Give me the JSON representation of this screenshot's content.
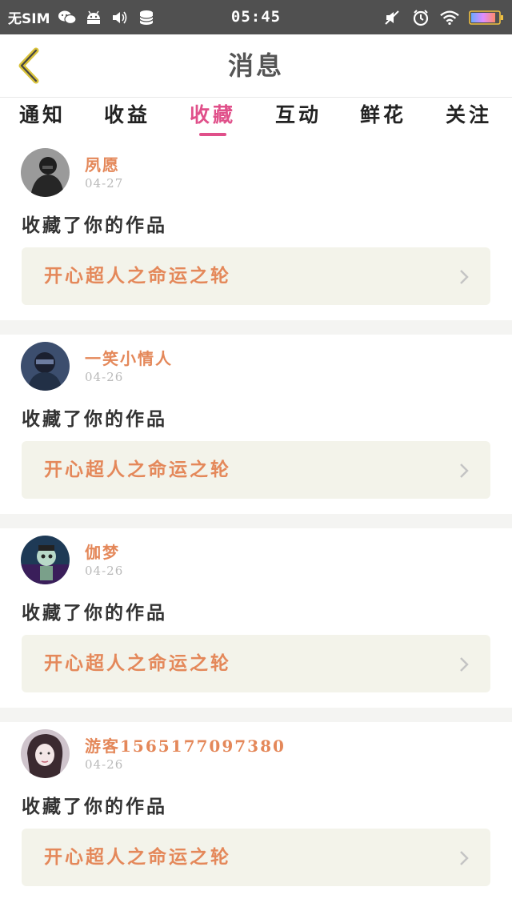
{
  "status_bar": {
    "carrier": "无SIM",
    "time": "05:45",
    "left_icons": [
      "wechat-icon",
      "android-icon",
      "volume-icon",
      "database-icon"
    ],
    "right_icons": [
      "mute-icon",
      "alarm-icon",
      "wifi-icon",
      "battery-icon"
    ]
  },
  "header": {
    "title": "消息"
  },
  "tabs": [
    {
      "label": "通知"
    },
    {
      "label": "收益"
    },
    {
      "label": "收藏"
    },
    {
      "label": "互动"
    },
    {
      "label": "鲜花"
    },
    {
      "label": "关注"
    }
  ],
  "active_tab": "收藏",
  "colors": {
    "accent": "#e0508a",
    "name_text": "#e4885a",
    "card_box": "#f3f3ea"
  },
  "messages": [
    {
      "username": "夙愿",
      "date": "04-27",
      "action": "收藏了你的作品",
      "work_title": "开心超人之命运之轮"
    },
    {
      "username": "一笑小情人",
      "date": "04-26",
      "action": "收藏了你的作品",
      "work_title": "开心超人之命运之轮"
    },
    {
      "username": "伽梦",
      "date": "04-26",
      "action": "收藏了你的作品",
      "work_title": "开心超人之命运之轮"
    },
    {
      "username": "游客1565177097380",
      "date": "04-26",
      "action": "收藏了你的作品",
      "work_title": "开心超人之命运之轮"
    }
  ]
}
